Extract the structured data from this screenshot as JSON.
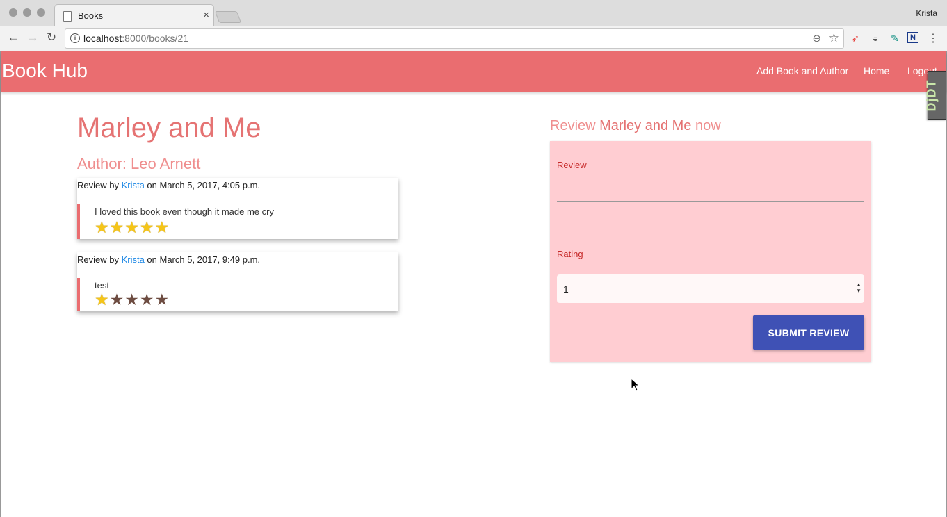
{
  "browser": {
    "tab_title": "Books",
    "tab_close": "×",
    "profile_name": "Krista",
    "url_host": "localhost",
    "url_path": ":8000/books/21",
    "back_icon": "←",
    "forward_icon": "→",
    "reload_icon": "↻",
    "zoom_icon": "⊖",
    "star_icon": "☆",
    "menu_icon": "⋮"
  },
  "navbar": {
    "brand": "Book Hub",
    "links": [
      "Add Book and Author",
      "Home",
      "Logout"
    ],
    "color": "#ea6d70"
  },
  "debug_toolbar": {
    "label": "DjDT"
  },
  "book": {
    "title": "Marley and Me",
    "author_line": "Author: Leo Arnett"
  },
  "reviews": [
    {
      "prefix": "Review by ",
      "reviewer": "Krista",
      "suffix": " on March 5, 2017, 4:05 p.m.",
      "text": "I loved this book even though it made me cry",
      "rating": 5,
      "max_rating": 5
    },
    {
      "prefix": "Review by ",
      "reviewer": "Krista",
      "suffix": " on March 5, 2017, 9:49 p.m.",
      "text": "test",
      "rating": 1,
      "max_rating": 5
    }
  ],
  "review_form": {
    "heading_prefix": "Review ",
    "heading_title": "Marley and Me",
    "heading_suffix": " now",
    "review_label": "Review",
    "review_value": "",
    "rating_label": "Rating",
    "rating_value": "1",
    "submit_label": "SUBMIT REVIEW",
    "submit_color": "#3f51b5"
  }
}
